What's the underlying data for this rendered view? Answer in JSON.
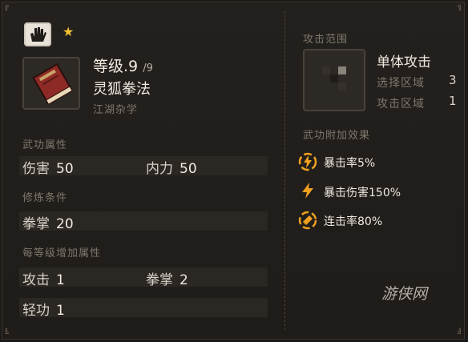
{
  "skill": {
    "level_label": "等级",
    "level_value": ".9",
    "level_max": "/9",
    "name": "灵狐拳法",
    "school": "江湖杂学"
  },
  "sections": {
    "attributes_title": "武功属性",
    "requirements_title": "修炼条件",
    "per_level_title": "每等级增加属性"
  },
  "attributes": [
    {
      "label": "伤害",
      "value": "50"
    },
    {
      "label": "内力",
      "value": "50"
    }
  ],
  "requirements": [
    {
      "label": "拳掌",
      "value": "20"
    }
  ],
  "per_level": [
    {
      "label": "攻击",
      "value": "1"
    },
    {
      "label": "拳掌",
      "value": "2"
    },
    {
      "label": "轻功",
      "value": "1"
    }
  ],
  "range": {
    "title": "攻击范围",
    "type": "单体攻击",
    "select_label": "选择区域",
    "select_value": "3",
    "attack_label": "攻击区域",
    "attack_value": "1"
  },
  "effects": {
    "title": "武功附加效果",
    "items": [
      {
        "text": "暴击率5%",
        "icon": "lightning-circle-icon"
      },
      {
        "text": "暴击伤害150%",
        "icon": "lightning-icon"
      },
      {
        "text": "连击率80%",
        "icon": "striped-circle-icon"
      }
    ]
  },
  "watermark": "游侠网",
  "colors": {
    "accent_orange": "#f0a020",
    "star": "#f2c232",
    "book_red": "#8e2a26"
  }
}
